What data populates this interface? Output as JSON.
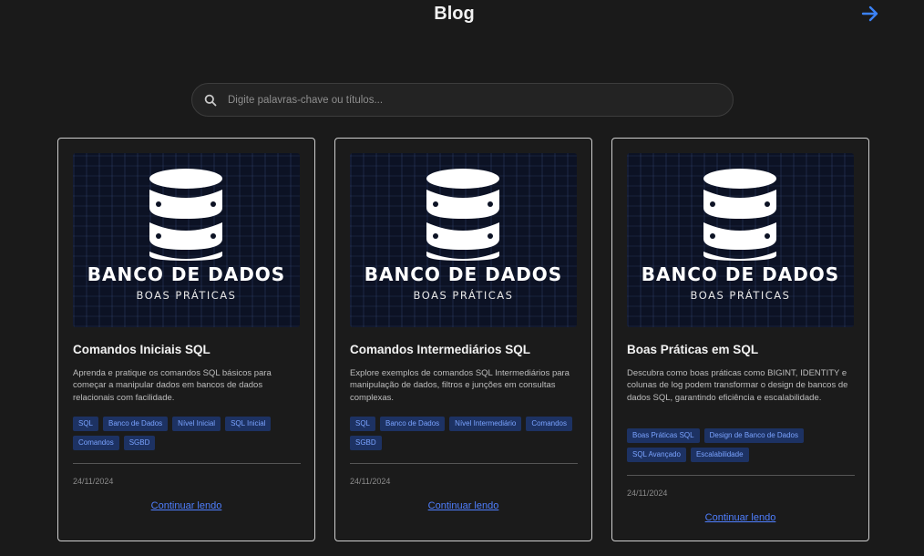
{
  "header": {
    "title": "Blog",
    "nav_icon": "arrow-right-icon",
    "accent_color": "#3b82f6"
  },
  "search": {
    "placeholder": "Digite palavras-chave ou títulos..."
  },
  "cards": [
    {
      "image": {
        "title": "BANCO DE DADOS",
        "subtitle": "BOAS PRÁTICAS"
      },
      "title": "Comandos Iniciais SQL",
      "description": "Aprenda e pratique os comandos SQL básicos para começar a manipular dados em bancos de dados relacionais com facilidade.",
      "tags": [
        "SQL",
        "Banco de Dados",
        "Nível Inicial",
        "SQL Inicial",
        "Comandos",
        "SGBD"
      ],
      "date": "24/11/2024",
      "link": "Continuar lendo"
    },
    {
      "image": {
        "title": "BANCO DE DADOS",
        "subtitle": "BOAS PRÁTICAS"
      },
      "title": "Comandos Intermediários SQL",
      "description": "Explore exemplos de comandos SQL Intermediários para manipulação de dados, filtros e junções em consultas complexas.",
      "tags": [
        "SQL",
        "Banco de Dados",
        "Nível Intermediário",
        "Comandos",
        "SGBD"
      ],
      "date": "24/11/2024",
      "link": "Continuar lendo"
    },
    {
      "image": {
        "title": "BANCO DE DADOS",
        "subtitle": "BOAS PRÁTICAS"
      },
      "title": "Boas Práticas em SQL",
      "description": "Descubra como boas práticas como BIGINT, IDENTITY e colunas de log podem transformar o design de bancos de dados SQL, garantindo eficiência e escalabilidade.",
      "tags": [
        "Boas Práticas SQL",
        "Design de Banco de Dados",
        "SQL Avançado",
        "Escalabilidade"
      ],
      "date": "24/11/2024",
      "link": "Continuar lendo"
    }
  ]
}
